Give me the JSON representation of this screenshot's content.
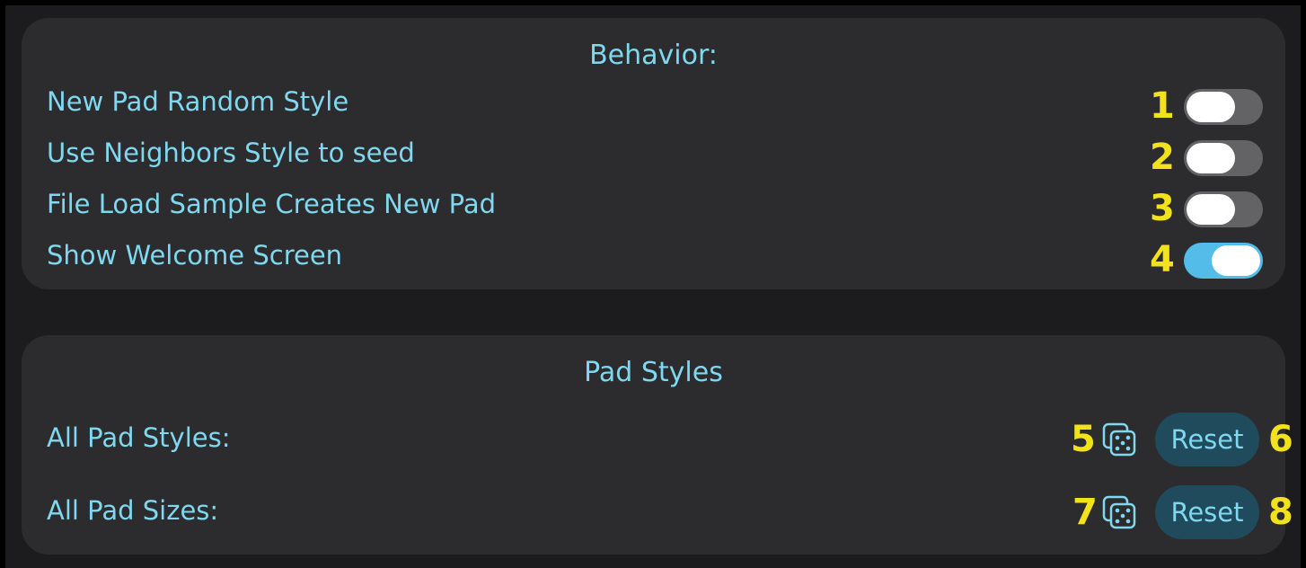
{
  "behavior": {
    "title": "Behavior:",
    "rows": [
      {
        "label": "New Pad Random Style",
        "marker": "1",
        "on": false
      },
      {
        "label": "Use Neighbors Style to seed",
        "marker": "2",
        "on": false
      },
      {
        "label": "File Load Sample Creates New Pad",
        "marker": "3",
        "on": false
      },
      {
        "label": "Show Welcome Screen",
        "marker": "4",
        "on": true
      }
    ]
  },
  "pad_styles": {
    "title": "Pad Styles",
    "rows": [
      {
        "label": "All Pad Styles:",
        "dice_marker": "5",
        "dice_icon": "dice-icon",
        "reset_label": "Reset",
        "reset_marker": "6"
      },
      {
        "label": "All Pad Sizes:",
        "dice_marker": "7",
        "dice_icon": "dice-icon",
        "reset_label": "Reset",
        "reset_marker": "8"
      }
    ]
  },
  "colors": {
    "text_accent": "#7fd8ef",
    "marker_yellow": "#f2e21c",
    "toggle_on": "#53bce8",
    "toggle_off": "#636366",
    "button_bg": "#1f4b5c",
    "panel_bg": "#2c2c2e"
  }
}
